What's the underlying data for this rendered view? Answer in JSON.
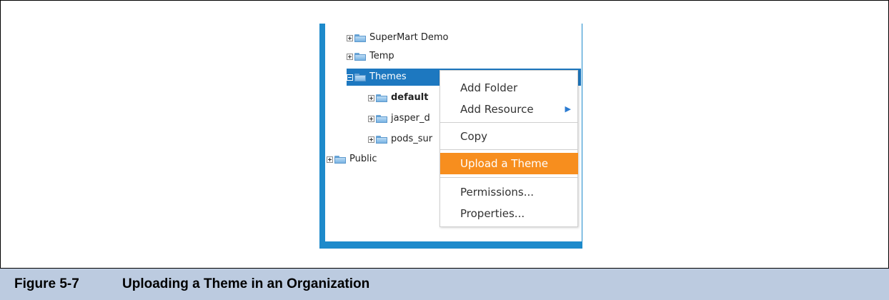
{
  "tree": {
    "items": [
      {
        "label": "SuperMart Demo",
        "expander": "plus"
      },
      {
        "label": "Temp",
        "expander": "plus"
      },
      {
        "label": "Themes",
        "expander": "minus",
        "selected": true
      },
      {
        "label": "default",
        "expander": "plus",
        "bold": true
      },
      {
        "label": "jasper_d",
        "expander": "plus"
      },
      {
        "label": "pods_sur",
        "expander": "plus"
      },
      {
        "label": "Public",
        "expander": "plus"
      }
    ]
  },
  "context_menu": {
    "add_folder": "Add Folder",
    "add_resource": "Add Resource",
    "copy": "Copy",
    "upload_theme": "Upload a Theme",
    "permissions": "Permissions...",
    "properties": "Properties..."
  },
  "caption": {
    "number": "Figure 5-7",
    "text": "Uploading a Theme in an Organization"
  },
  "colors": {
    "frame_blue": "#1d8acb",
    "selection_blue": "#1d78c0",
    "menu_highlight": "#f78e1e",
    "caption_bg": "#bccbe0"
  }
}
